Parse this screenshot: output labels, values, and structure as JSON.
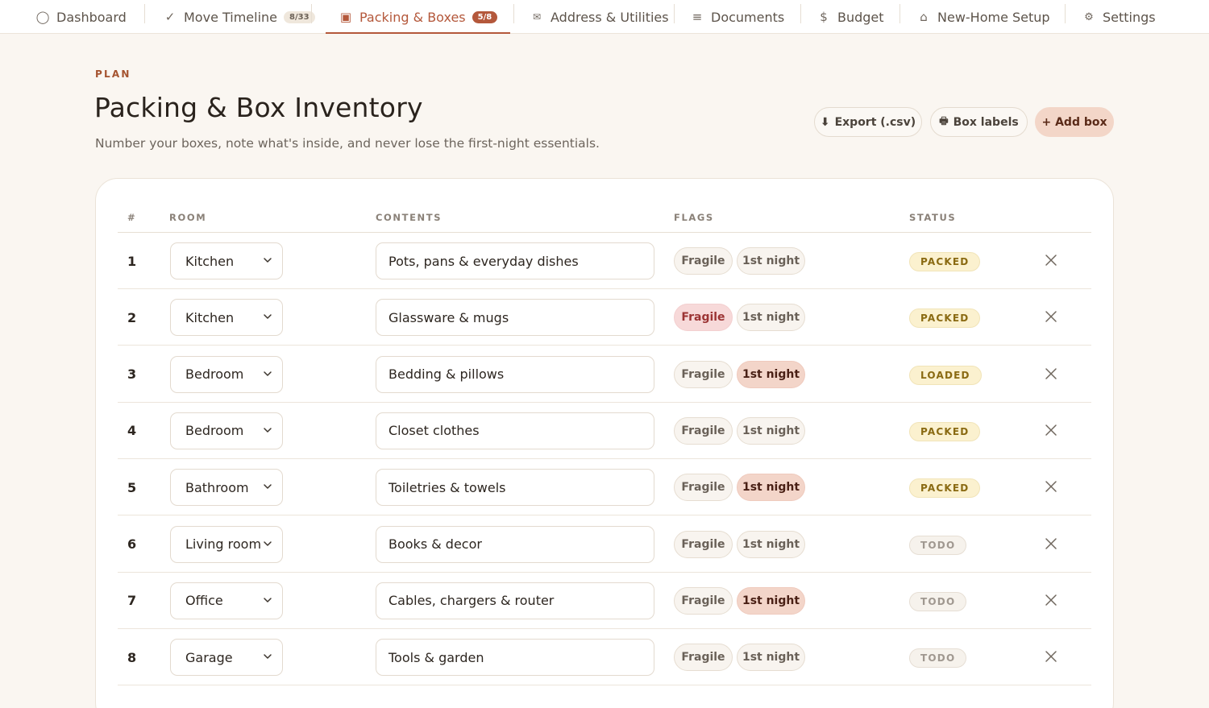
{
  "nav": {
    "items": [
      {
        "icon": "circle-icon",
        "glyph": "◯",
        "label": "Dashboard",
        "badge": ""
      },
      {
        "icon": "check-icon",
        "glyph": "✓",
        "label": "Move Timeline",
        "badge": "8/33"
      },
      {
        "icon": "box-icon",
        "glyph": "▣",
        "label": "Packing & Boxes",
        "badge": "5/8"
      },
      {
        "icon": "envelope-icon",
        "glyph": "✉",
        "label": "Address & Utilities",
        "badge": ""
      },
      {
        "icon": "menu-lines-icon",
        "glyph": "≡",
        "label": "Documents",
        "badge": ""
      },
      {
        "icon": "dollar-icon",
        "glyph": "$",
        "label": "Budget",
        "badge": ""
      },
      {
        "icon": "home-icon",
        "glyph": "⌂",
        "label": "New-Home Setup",
        "badge": ""
      },
      {
        "icon": "gear-icon",
        "glyph": "⚙",
        "label": "Settings",
        "badge": ""
      }
    ],
    "active_index": 2
  },
  "header": {
    "eyebrow": "PLAN",
    "title": "Packing & Box Inventory",
    "subtitle": "Number your boxes, note what's inside, and never lose the first-night essentials."
  },
  "actions": {
    "export_icon": "⬇",
    "export_label": "Export (.csv)",
    "labels_icon": "🖶",
    "labels_label": "Box labels",
    "add_label": "+ Add box"
  },
  "table": {
    "columns": {
      "num": "#",
      "room": "ROOM",
      "contents": "CONTENTS",
      "flags": "FLAGS",
      "status": "STATUS"
    },
    "flag_labels": {
      "fragile": "Fragile",
      "night": "1st night"
    },
    "rows": [
      {
        "num": "1",
        "room": "Kitchen",
        "contents": "Pots, pans & everyday dishes",
        "fragile": false,
        "night": false,
        "status": "PACKED"
      },
      {
        "num": "2",
        "room": "Kitchen",
        "contents": "Glassware & mugs",
        "fragile": true,
        "night": false,
        "status": "PACKED"
      },
      {
        "num": "3",
        "room": "Bedroom",
        "contents": "Bedding & pillows",
        "fragile": false,
        "night": true,
        "status": "LOADED"
      },
      {
        "num": "4",
        "room": "Bedroom",
        "contents": "Closet clothes",
        "fragile": false,
        "night": false,
        "status": "PACKED"
      },
      {
        "num": "5",
        "room": "Bathroom",
        "contents": "Toiletries & towels",
        "fragile": false,
        "night": true,
        "status": "PACKED"
      },
      {
        "num": "6",
        "room": "Living room",
        "contents": "Books & decor",
        "fragile": false,
        "night": false,
        "status": "TODO"
      },
      {
        "num": "7",
        "room": "Office",
        "contents": "Cables, chargers & router",
        "fragile": false,
        "night": true,
        "status": "TODO"
      },
      {
        "num": "8",
        "room": "Garage",
        "contents": "Tools & garden",
        "fragile": false,
        "night": false,
        "status": "TODO"
      }
    ]
  },
  "colors": {
    "accent": "#b4583b",
    "background": "#faf6f1",
    "status_packed": "#8a6a12",
    "status_todo": "#a09890",
    "fragile_on": "#f7d9d9",
    "night_on": "#f3d5c9"
  }
}
